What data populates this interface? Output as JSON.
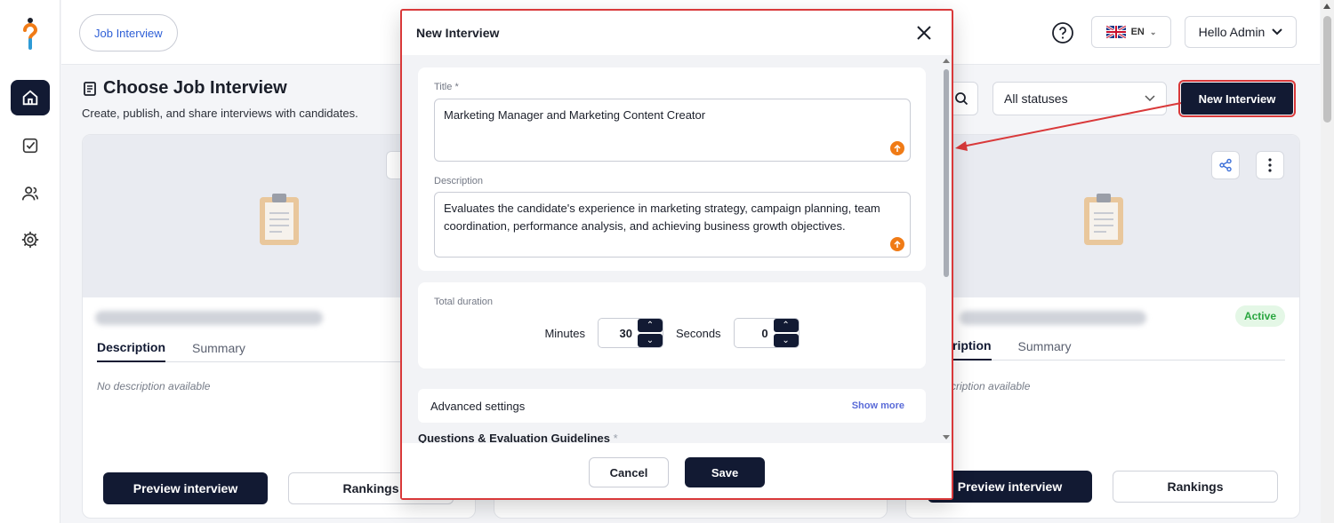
{
  "header": {
    "crumb": "Job Interview",
    "language": "EN",
    "user": "Hello Admin"
  },
  "page": {
    "title": "Choose Job Interview",
    "subtitle": "Create, publish, and share interviews with candidates."
  },
  "toolbar": {
    "status_filter": "All statuses",
    "new_interview": "New Interview"
  },
  "cards": [
    {
      "tabs": [
        "Description",
        "Summary"
      ],
      "no_description": "No description available",
      "preview": "Preview interview",
      "rankings": "Rankings"
    },
    {
      "status": "Active",
      "tabs": [
        "ription",
        "Summary"
      ],
      "no_description": "cription available",
      "preview": "Preview interview",
      "rankings": "Rankings"
    }
  ],
  "modal": {
    "title": "New Interview",
    "title_label": "Title",
    "title_value": "Marketing Manager and Marketing Content Creator",
    "description_label": "Description",
    "description_value": "Evaluates the candidate's experience in marketing strategy, campaign planning, team coordination, performance analysis, and achieving business growth objectives.",
    "duration_label": "Total duration",
    "minutes_label": "Minutes",
    "minutes_value": "30",
    "seconds_label": "Seconds",
    "seconds_value": "0",
    "advanced_label": "Advanced settings",
    "show_more": "Show more",
    "questions_label": "Questions & Evaluation Guidelines",
    "required_mark": "*",
    "cancel": "Cancel",
    "save": "Save"
  },
  "colors": {
    "primary": "#121a33",
    "accent": "#d9393a",
    "link": "#2e5fd6",
    "upload": "#f07b16",
    "active_badge": "#2aa640"
  }
}
